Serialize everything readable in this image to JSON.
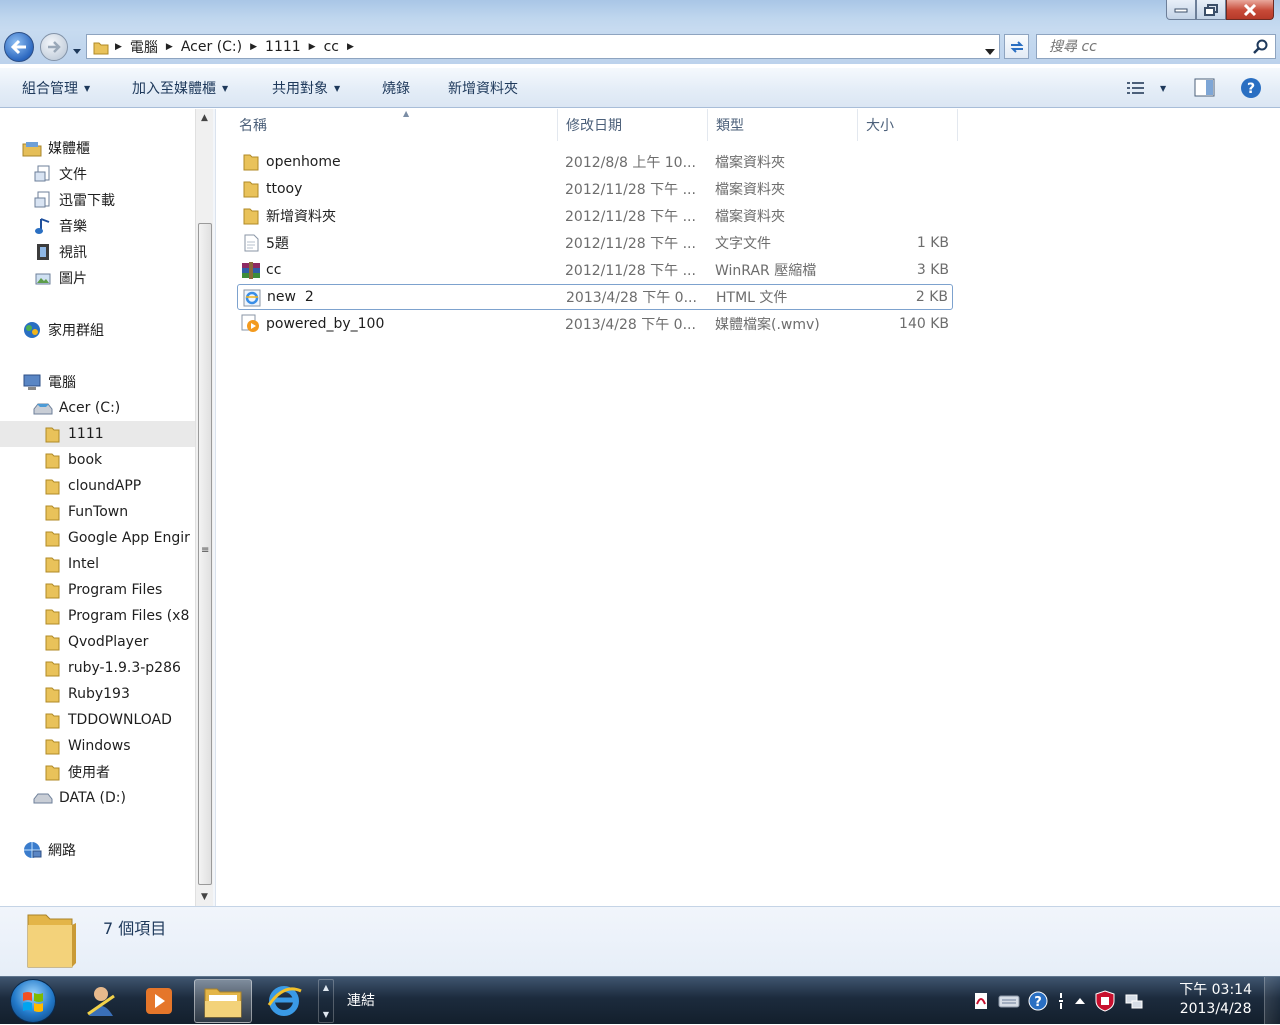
{
  "address": {
    "crumbs": [
      "電腦",
      "Acer (C:)",
      "1111",
      "cc"
    ]
  },
  "search": {
    "placeholder": "搜尋 cc"
  },
  "toolbar": {
    "organize": "組合管理",
    "add_to_library": "加入至媒體櫃",
    "share": "共用對象",
    "burn": "燒錄",
    "new_folder": "新增資料夾"
  },
  "nav": {
    "items": [
      "媒體櫃",
      "文件",
      "迅雷下載",
      "音樂",
      "視訊",
      "圖片",
      "家用群組",
      "電腦",
      "Acer (C:)",
      "1111",
      "book",
      "cloundAPP",
      "FunTown",
      "Google App Engir",
      "Intel",
      "Program Files",
      "Program Files (x8",
      "QvodPlayer",
      "ruby-1.9.3-p286",
      "Ruby193",
      "TDDOWNLOAD",
      "Windows",
      "使用者",
      "DATA (D:)",
      "網路"
    ]
  },
  "columns": {
    "name": "名稱",
    "date": "修改日期",
    "type": "類型",
    "size": "大小"
  },
  "files": [
    {
      "name": "openhome",
      "date": "2012/8/8 上午 10...",
      "type": "檔案資料夾",
      "size": "",
      "icon": "folder-icon"
    },
    {
      "name": "ttooy",
      "date": "2012/11/28 下午 ...",
      "type": "檔案資料夾",
      "size": "",
      "icon": "folder-icon"
    },
    {
      "name": "新增資料夾",
      "date": "2012/11/28 下午 ...",
      "type": "檔案資料夾",
      "size": "",
      "icon": "folder-icon"
    },
    {
      "name": "5題",
      "date": "2012/11/28 下午 ...",
      "type": "文字文件",
      "size": "1 KB",
      "icon": "text-file-icon"
    },
    {
      "name": "cc",
      "date": "2012/11/28 下午 ...",
      "type": "WinRAR 壓縮檔",
      "size": "3 KB",
      "icon": "winrar-icon"
    },
    {
      "name": "new  2",
      "date": "2013/4/28 下午 0...",
      "type": "HTML 文件",
      "size": "2 KB",
      "icon": "ie-file-icon"
    },
    {
      "name": "powered_by_100",
      "date": "2013/4/28 下午 0...",
      "type": "媒體檔案(.wmv)",
      "size": "140 KB",
      "icon": "media-file-icon"
    }
  ],
  "details": {
    "count": "7 個項目"
  },
  "taskbar": {
    "links_label": "連結",
    "clock_time": "下午 03:14",
    "clock_date": "2013/4/28"
  }
}
